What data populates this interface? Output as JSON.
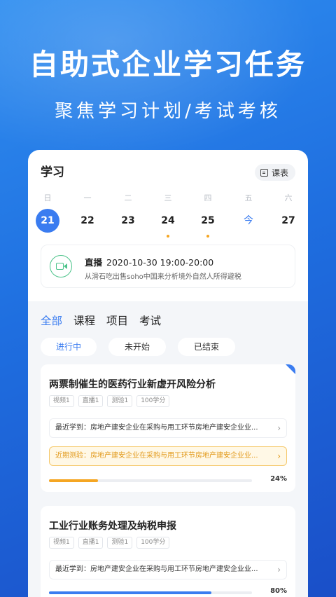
{
  "promo": {
    "headline": "自助式企业学习任务",
    "subline": "聚焦学习计划/考试考核"
  },
  "header": {
    "title": "学习",
    "schedule_label": "课表"
  },
  "calendar": {
    "weekdays": [
      "日",
      "一",
      "二",
      "三",
      "四",
      "五",
      "六"
    ],
    "dates": [
      {
        "label": "21",
        "state": "selected",
        "has_event": false
      },
      {
        "label": "22",
        "state": "normal",
        "has_event": false
      },
      {
        "label": "23",
        "state": "normal",
        "has_event": false
      },
      {
        "label": "24",
        "state": "normal",
        "has_event": true
      },
      {
        "label": "25",
        "state": "normal",
        "has_event": true
      },
      {
        "label": "今",
        "state": "today",
        "has_event": false
      },
      {
        "label": "27",
        "state": "normal",
        "has_event": false
      }
    ]
  },
  "live": {
    "tag": "直播",
    "time": "2020-10-30 19:00-20:00",
    "description": "从滑石吃出售soho中国来分析境外自然人所得避税"
  },
  "tabs": [
    "全部",
    "课程",
    "项目",
    "考试"
  ],
  "filters": [
    "进行中",
    "未开始",
    "已结束"
  ],
  "courses": [
    {
      "title": "两票制催生的医药行业新虚开风险分析",
      "badges": [
        "视频1",
        "直播1",
        "测验1",
        "100学分"
      ],
      "recent_study": "最近学到：房地产建安企业在采购与用工环节房地产建安企业业...",
      "recent_exam": "近期测验：房地产建安企业在采购与用工环节房地产建安企业业...",
      "progress_label": "24%",
      "progress": 0.24,
      "progress_color": "#f5a623"
    },
    {
      "title": "工业行业账务处理及纳税申报",
      "badges": [
        "视频1",
        "直播1",
        "测验1",
        "100学分"
      ],
      "recent_study": "最近学到：房地产建安企业在采购与用工环节房地产建安企业业...",
      "progress_label": "80%",
      "progress": 0.8,
      "progress_color": "#3a7cf0"
    }
  ]
}
